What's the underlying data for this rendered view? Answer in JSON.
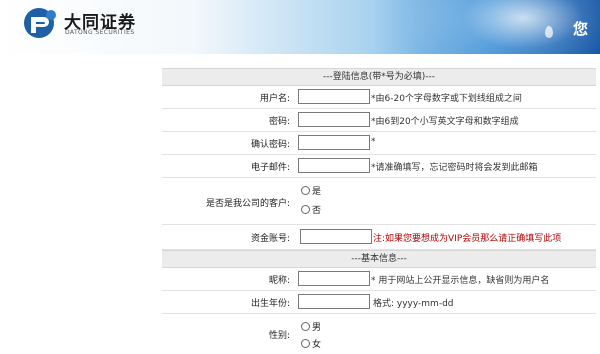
{
  "header": {
    "brand_cn": "大同证券",
    "brand_en": "DATONG SECURITIES",
    "right_text": "您 具"
  },
  "login_section": {
    "title": "---登陆信息(带*号为必填)---",
    "fields": {
      "username": {
        "label": "用户名:",
        "value": "",
        "hint": "*由6-20个字母数字或下划线组成之间"
      },
      "password": {
        "label": "密码:",
        "value": "",
        "hint": "*由6到20个小写英文字母和数字组成"
      },
      "confirm_password": {
        "label": "确认密码:",
        "value": "",
        "hint": "*"
      },
      "email": {
        "label": "电子邮件:",
        "value": "",
        "hint": "*请准确填写，忘记密码时将会发到此邮箱"
      }
    },
    "is_client": {
      "label": "是否是我公司的客户:",
      "options": [
        "是",
        "否"
      ],
      "selected": null
    },
    "fund_account": {
      "label": "资金账号:",
      "value": "",
      "note": "注:如果您要想成为VIP会员那么请正确填写此项"
    }
  },
  "basic_section": {
    "title": "---基本信息---",
    "nickname": {
      "label": "昵称:",
      "value": "",
      "hint": "* 用于网站上公开显示信息，缺省则为用户名"
    },
    "birth": {
      "label": "出生年份:",
      "value": "",
      "hint": "格式: yyyy-mm-dd"
    },
    "gender": {
      "label": "性别:",
      "options": [
        "男",
        "女"
      ],
      "selected": null
    }
  },
  "colors": {
    "accent_blue": "#0d4fa3",
    "note_red": "#b30000",
    "section_bg": "#ececec"
  }
}
